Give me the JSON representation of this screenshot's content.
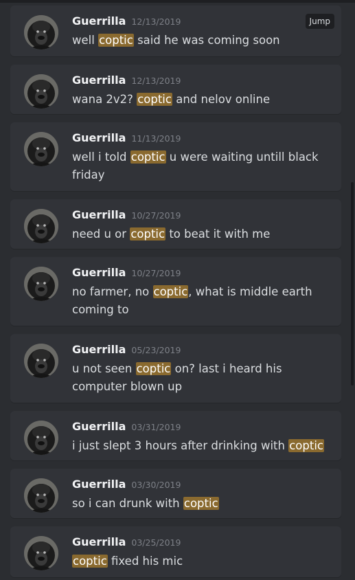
{
  "jump_label": "Jump",
  "results": [
    {
      "author": "Guerrilla",
      "timestamp": "12/13/2019",
      "pre": "well ",
      "hit": "coptic",
      "post": " said he was coming soon"
    },
    {
      "author": "Guerrilla",
      "timestamp": "12/13/2019",
      "pre": "wana 2v2? ",
      "hit": "coptic",
      "post": " and nelov online"
    },
    {
      "author": "Guerrilla",
      "timestamp": "11/13/2019",
      "pre": "well i told ",
      "hit": "coptic",
      "post": " u were waiting untill black friday"
    },
    {
      "author": "Guerrilla",
      "timestamp": "10/27/2019",
      "pre": "need u or ",
      "hit": "coptic",
      "post": " to beat it with me"
    },
    {
      "author": "Guerrilla",
      "timestamp": "10/27/2019",
      "pre": "no farmer, no ",
      "hit": "coptic",
      "post": ", what is middle earth coming to"
    },
    {
      "author": "Guerrilla",
      "timestamp": "05/23/2019",
      "pre": "u not seen ",
      "hit": "coptic",
      "post": " on? last i heard his computer blown up"
    },
    {
      "author": "Guerrilla",
      "timestamp": "03/31/2019",
      "pre": "i just slept 3 hours after drinking with ",
      "hit": "coptic",
      "post": ""
    },
    {
      "author": "Guerrilla",
      "timestamp": "03/30/2019",
      "pre": "so i can drunk with ",
      "hit": "coptic",
      "post": ""
    },
    {
      "author": "Guerrilla",
      "timestamp": "03/25/2019",
      "pre": "",
      "hit": "coptic",
      "post": " fixed his mic"
    }
  ],
  "colors": {
    "highlight": "#8a6a2f",
    "background": "#2b2d31",
    "card": "#313338"
  },
  "icons": {
    "avatar": "gorilla-avatar-icon"
  }
}
